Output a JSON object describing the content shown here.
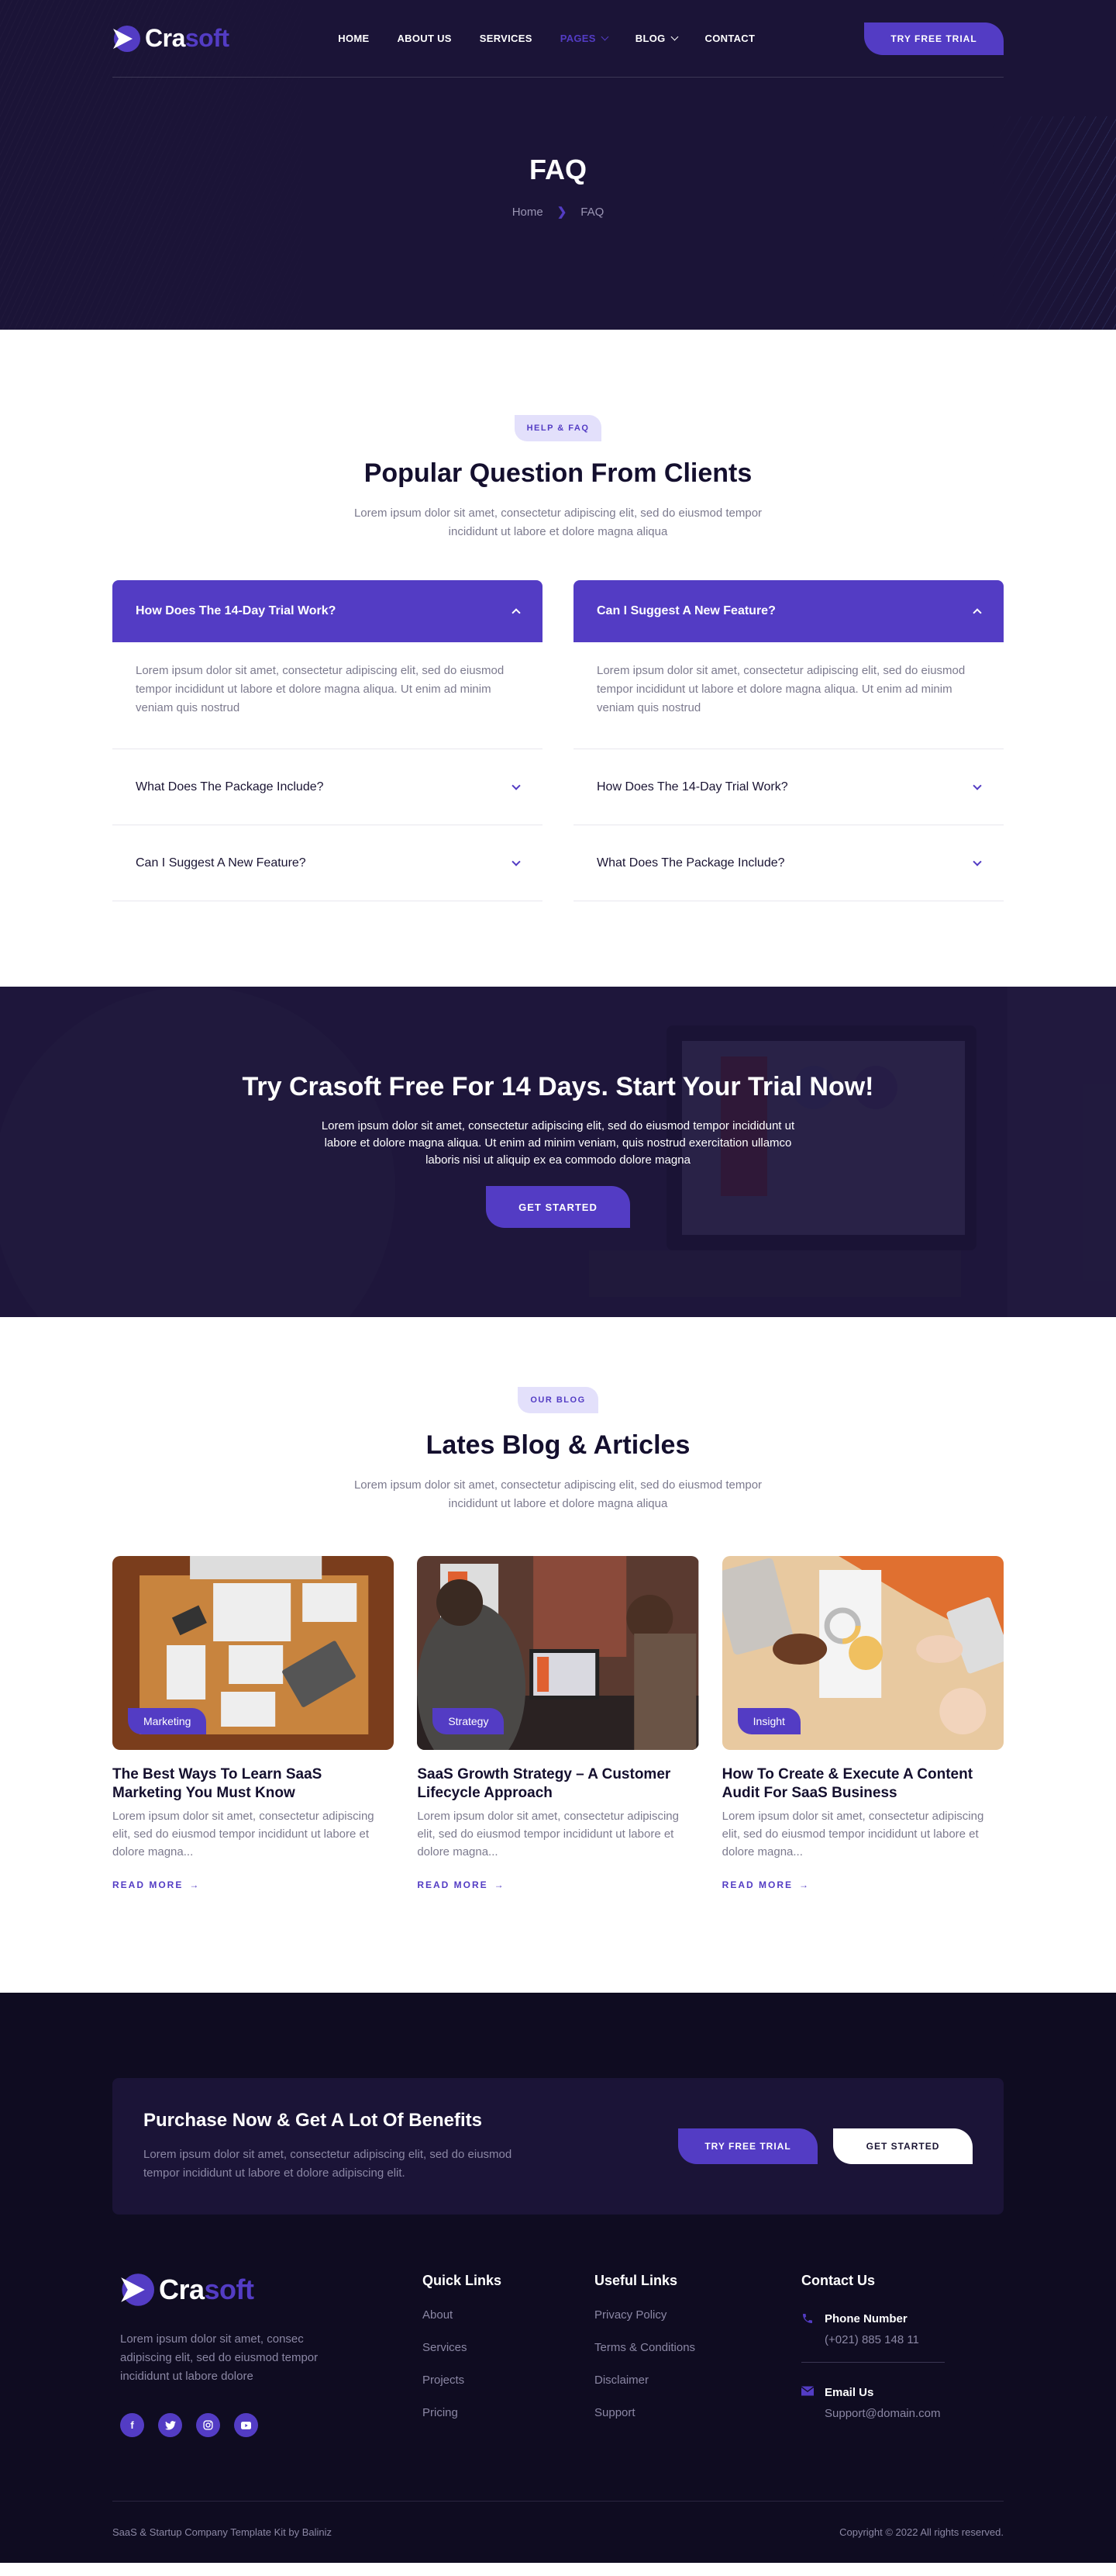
{
  "brand": {
    "name_white": "Cra",
    "name_purple": "soft",
    "accent": "#533cc4",
    "dark": "#1b1437"
  },
  "nav": {
    "items": [
      {
        "label": "HOME"
      },
      {
        "label": "ABOUT US"
      },
      {
        "label": "SERVICES"
      },
      {
        "label": "PAGES",
        "dropdown": true,
        "active": true
      },
      {
        "label": "BLOG",
        "dropdown": true
      },
      {
        "label": "CONTACT"
      }
    ],
    "cta": "TRY FREE TRIAL"
  },
  "hero": {
    "title": "FAQ",
    "breadcrumb": {
      "home": "Home",
      "current": "FAQ"
    }
  },
  "faq": {
    "tag": "HELP & FAQ",
    "title": "Popular Question From Clients",
    "subtitle": "Lorem ipsum dolor sit amet, consectetur adipiscing elit, sed do eiusmod tempor incididunt ut labore et dolore magna aliqua",
    "left": [
      {
        "q": "How Does The 14-Day Trial Work?",
        "a": "Lorem ipsum dolor sit amet, consectetur adipiscing elit, sed do eiusmod tempor incididunt ut labore et dolore magna aliqua. Ut enim ad minim veniam quis nostrud",
        "open": true
      },
      {
        "q": "What Does The Package Include?"
      },
      {
        "q": "Can I Suggest A New Feature?"
      }
    ],
    "right": [
      {
        "q": "Can I Suggest A New Feature?",
        "a": "Lorem ipsum dolor sit amet, consectetur adipiscing elit, sed do eiusmod tempor incididunt ut labore et dolore magna aliqua. Ut enim ad minim veniam quis nostrud",
        "open": true
      },
      {
        "q": "How Does The 14-Day Trial Work?"
      },
      {
        "q": "What Does The Package Include?"
      }
    ]
  },
  "cta": {
    "title": "Try Crasoft Free For 14 Days. Start Your Trial Now!",
    "text": "Lorem ipsum dolor sit amet, consectetur adipiscing elit, sed do eiusmod tempor incididunt ut labore et dolore magna aliqua. Ut enim ad minim veniam, quis nostrud exercitation ullamco laboris nisi ut aliquip ex ea commodo dolore magna",
    "button": "GET STARTED"
  },
  "blog": {
    "tag": "OUR BLOG",
    "title": "Lates Blog & Articles",
    "subtitle": "Lorem ipsum dolor sit amet, consectetur adipiscing elit, sed do eiusmod tempor incididunt ut labore et dolore magna aliqua",
    "posts": [
      {
        "category": "Marketing",
        "title": "The Best Ways To Learn SaaS Marketing You Must Know",
        "excerpt": "Lorem ipsum dolor sit amet, consectetur adipiscing elit, sed do eiusmod tempor incididunt ut labore et dolore magna...",
        "link": "READ MORE"
      },
      {
        "category": "Strategy",
        "title": "SaaS Growth Strategy – A Customer Lifecycle Approach",
        "excerpt": "Lorem ipsum dolor sit amet, consectetur adipiscing elit, sed do eiusmod tempor incididunt ut labore et dolore magna...",
        "link": "READ MORE"
      },
      {
        "category": "Insight",
        "title": "How To Create & Execute A Content Audit For SaaS Business",
        "excerpt": "Lorem ipsum dolor sit amet, consectetur adipiscing elit, sed do eiusmod tempor incididunt ut labore et dolore magna...",
        "link": "READ MORE"
      }
    ]
  },
  "footer": {
    "promo": {
      "title": "Purchase Now & Get A Lot Of Benefits",
      "text": "Lorem ipsum dolor sit amet, consectetur adipiscing elit, sed do eiusmod tempor incididunt ut labore et dolore adipiscing elit.",
      "primary": "TRY FREE TRIAL",
      "secondary": "GET STARTED"
    },
    "about": "Lorem ipsum dolor sit amet, consec adipiscing elit, sed do eiusmod tempor incididunt ut labore dolore",
    "socials": [
      "facebook",
      "twitter",
      "instagram",
      "youtube"
    ],
    "quick_links": {
      "title": "Quick Links",
      "items": [
        "About",
        "Services",
        "Projects",
        "Pricing"
      ]
    },
    "useful_links": {
      "title": "Useful Links",
      "items": [
        "Privacy Policy",
        "Terms & Conditions",
        "Disclaimer",
        "Support"
      ]
    },
    "contact": {
      "title": "Contact Us",
      "phone_label": "Phone Number",
      "phone": "(+021) 885 148 11",
      "email_label": "Email Us",
      "email": "Support@domain.com"
    },
    "credit": "SaaS & Startup Company Template Kit by Baliniz",
    "copyright": "Copyright © 2022 All rights reserved."
  }
}
